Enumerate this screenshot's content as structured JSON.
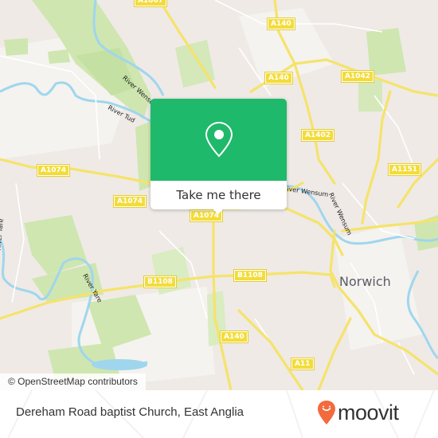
{
  "map": {
    "place_labels": [
      {
        "name": "Norwich"
      }
    ],
    "road_labels": [
      "A1067",
      "A140",
      "A140",
      "A1042",
      "A1402",
      "A1151",
      "A1074",
      "A1074",
      "A1074",
      "B1108",
      "B1108",
      "A140",
      "A11"
    ],
    "water_labels": [
      "River Wensum",
      "River Tud",
      "River Wensum",
      "River Yare",
      "River Yare",
      "River Wensum"
    ],
    "colors": {
      "land": "#efeae6",
      "park": "#cfe6b0",
      "water": "#9fd6ee",
      "road_major": "#f5e36b",
      "road_minor": "#ffffff"
    }
  },
  "popup": {
    "button_label": "Take me there",
    "icon": "map-pin-icon",
    "color": "#1fb96b"
  },
  "attribution": "© OpenStreetMap contributors",
  "footer": {
    "location_title": "Dereham Road baptist Church, East Anglia",
    "brand": "moovit",
    "brand_color": "#f26a3d"
  }
}
